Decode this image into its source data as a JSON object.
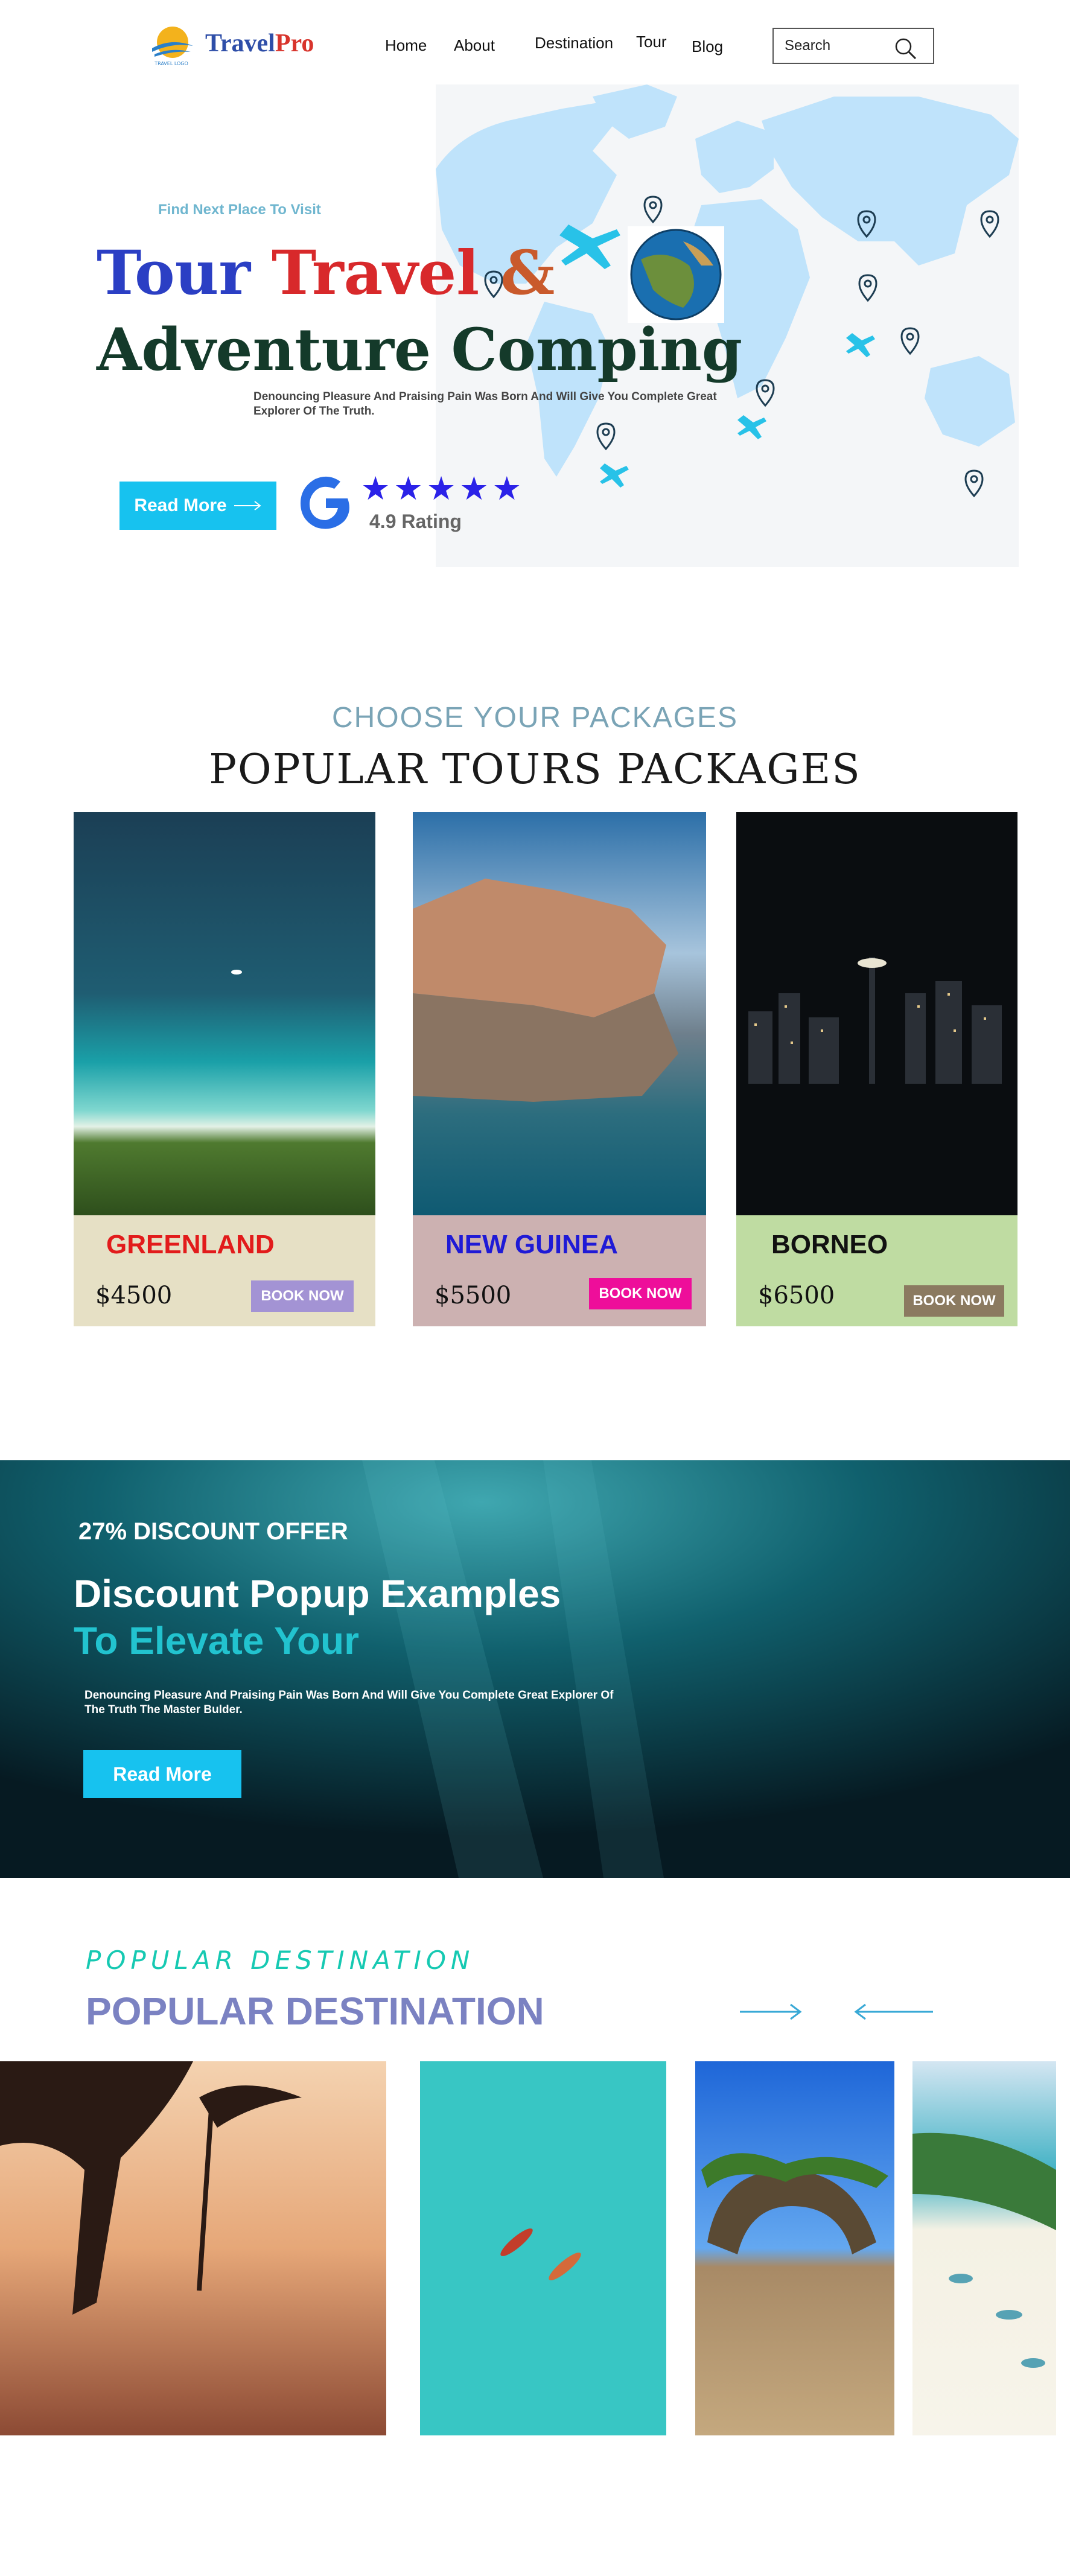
{
  "brand": {
    "name_part1": "Travel",
    "name_part2": "Pro",
    "logo_caption": "TRAVEL LOGO"
  },
  "nav": {
    "items": [
      {
        "label": "Home"
      },
      {
        "label": "About"
      },
      {
        "label": "Destination"
      },
      {
        "label": "Tour"
      },
      {
        "label": "Blog"
      }
    ],
    "search_placeholder": "Search"
  },
  "hero": {
    "kicker": "Find Next Place To Visit",
    "title_word1": "Tour",
    "title_word2": "Travel",
    "title_word3": "&",
    "title_line2": "Adventure  Comping",
    "description": "Denouncing  Pleasure And Praising  Pain Was  Born And Will Give  You Complete Great Explorer Of The Truth.",
    "button_label": "Read More",
    "stars": "★★★★★",
    "rating": 4.9,
    "rating_label": "4.9 Rating"
  },
  "packages": {
    "kicker": "CHOOSE YOUR PACKAGES",
    "title": "POPULAR TOURS PACKAGES",
    "cards": [
      {
        "place": "GREENLAND",
        "price": "$4500",
        "button": "BOOK NOW",
        "place_color": "#e21b1b",
        "footer_color": "#e6e0c5",
        "button_color": "#a393d4"
      },
      {
        "place": "NEW GUINEA",
        "price": "$5500",
        "button": "BOOK NOW",
        "place_color": "#1f1ad6",
        "footer_color": "#ccb1b1",
        "button_color": "#ee0e9a"
      },
      {
        "place": "BORNEO",
        "price": "$6500",
        "button": "BOOK NOW",
        "place_color": "#111111",
        "footer_color": "#bfdca2",
        "button_color": "#8b7a60"
      }
    ]
  },
  "discount": {
    "kicker": "27%  DISCOUNT OFFER",
    "title_line1": "Discount Popup Examples",
    "title_line2": "To Elevate Your",
    "description": "Denouncing  Pleasure And Praising  Pain Was  Born And Will Give  You Complete Great Explorer Of The Truth The Master Bulder.",
    "button_label": "Read More"
  },
  "popular": {
    "kicker": "POPULAR DESTINATION",
    "title": "POPULAR DESTINATION",
    "arrow_color": "#39a9d6"
  },
  "colors": {
    "accent": "#17c2ef",
    "map": "#bfe3fb"
  }
}
